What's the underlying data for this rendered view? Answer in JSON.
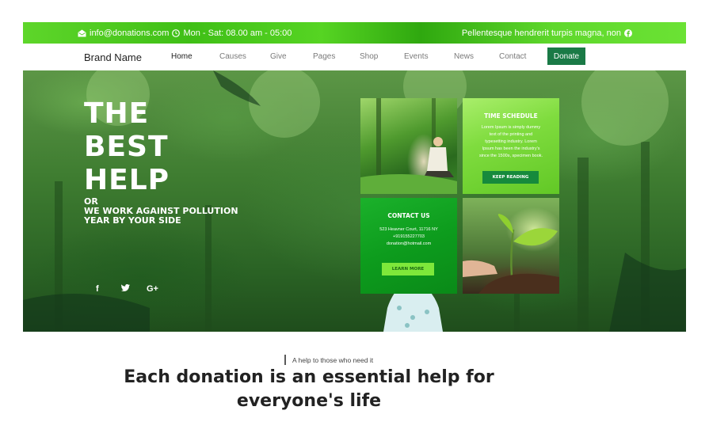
{
  "topbar": {
    "email": "info@donations.com",
    "hours": "Mon - Sat: 08.00 am - 05:00",
    "tagline": "Pellentesque hendrerit turpis magna, non"
  },
  "nav": {
    "brand": "Brand Name",
    "items": [
      "Home",
      "Causes",
      "Give",
      "Pages",
      "Shop",
      "Events",
      "News",
      "Contact"
    ],
    "active": "Home",
    "donate": "Donate"
  },
  "hero": {
    "title_lines": [
      "THE",
      "BEST",
      "HELP"
    ],
    "sub_lines": [
      "OR",
      "WE WORK AGAINST POLLUTION",
      "YEAR BY YOUR SIDE"
    ],
    "social": [
      "f",
      "twitter",
      "G+"
    ]
  },
  "tiles": {
    "schedule": {
      "title": "TIME SCHEDULE",
      "text_lines": [
        "Lorem Ipsum is simply dummy",
        "text of the printing and",
        "typesetting industry. Lorem",
        "Ipsum has been the industry's",
        "since the 1500s, specimen book."
      ],
      "button": "KEEP READING"
    },
    "contact": {
      "title": "CONTACT US",
      "address": "523 Heavner Court, 11716 NY",
      "phone": "+919155227703",
      "email": "donation@hotmail.com",
      "button": "LEARN MORE"
    }
  },
  "section": {
    "tagline": "A help to those who need it",
    "headline_lines": [
      "Each donation is an essential help for",
      "everyone's life"
    ]
  },
  "colors": {
    "topbar_green": "#4fcc1f",
    "donate_green": "#1a7a46",
    "tile_lime": "#7fdc3e",
    "tile_green": "#0d9c1d"
  }
}
